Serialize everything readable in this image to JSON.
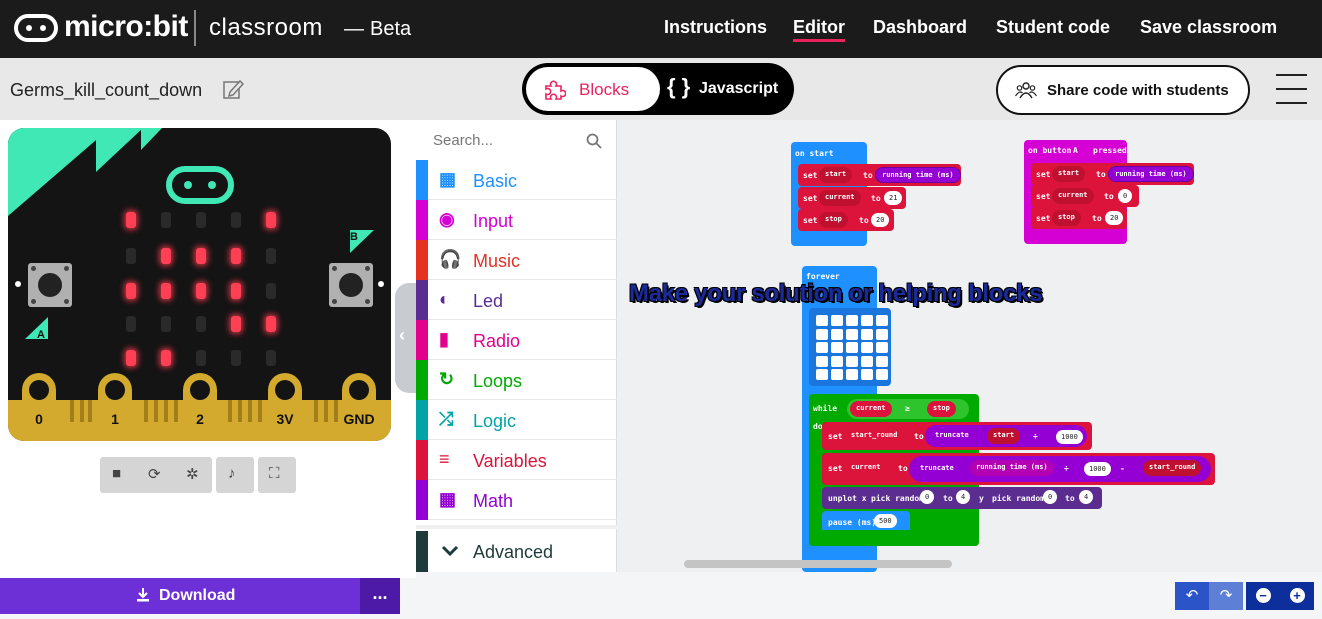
{
  "header": {
    "brand": "micro:bit",
    "product": "classroom",
    "dash": "—",
    "beta": "Beta",
    "nav": [
      "Instructions",
      "Editor",
      "Dashboard",
      "Student code",
      "Save classroom"
    ],
    "active_nav": "Editor"
  },
  "project": {
    "name": "Germs_kill_count_down"
  },
  "editor_toggle": {
    "blocks": "Blocks",
    "javascript": "Javascript",
    "selected": "Blocks"
  },
  "share": {
    "label": "Share code with students"
  },
  "simulator": {
    "leds_on": [
      [
        1,
        0,
        0,
        0,
        1
      ],
      [
        0,
        1,
        1,
        1,
        0
      ],
      [
        1,
        1,
        1,
        1,
        0
      ],
      [
        0,
        0,
        0,
        1,
        1
      ],
      [
        1,
        1,
        0,
        0,
        0
      ]
    ],
    "button_a": "A",
    "button_b": "B",
    "pins": [
      "0",
      "1",
      "2",
      "3V",
      "GND"
    ]
  },
  "toolbox": {
    "search_placeholder": "Search...",
    "categories": [
      {
        "label": "Basic",
        "color": "#1e90ff"
      },
      {
        "label": "Input",
        "color": "#d400d4"
      },
      {
        "label": "Music",
        "color": "#e63022"
      },
      {
        "label": "Led",
        "color": "#5c2d91"
      },
      {
        "label": "Radio",
        "color": "#e3008c"
      },
      {
        "label": "Loops",
        "color": "#00aa00"
      },
      {
        "label": "Logic",
        "color": "#00a4a6"
      },
      {
        "label": "Variables",
        "color": "#dc143c"
      },
      {
        "label": "Math",
        "color": "#9400d3"
      }
    ],
    "advanced": "Advanced"
  },
  "workspace": {
    "overlay_text": "Make your solution or helping blocks",
    "on_start": {
      "header": "on start",
      "rows": [
        {
          "set": "set",
          "var": "start",
          "to": "to",
          "value": "running time (ms)"
        },
        {
          "set": "set",
          "var": "current",
          "to": "to",
          "value": "21"
        },
        {
          "set": "set",
          "var": "stop",
          "to": "to",
          "value": "20"
        }
      ]
    },
    "on_button": {
      "header": "on button",
      "button": "A",
      "event": "pressed",
      "rows": [
        {
          "set": "set",
          "var": "start",
          "to": "to",
          "value": "running time (ms)"
        },
        {
          "set": "set",
          "var": "current",
          "to": "to",
          "value": "0"
        },
        {
          "set": "set",
          "var": "stop",
          "to": "to",
          "value": "20"
        }
      ]
    },
    "forever": {
      "header": "forever",
      "while": "while",
      "do": "do",
      "cond_left": "current",
      "cond_op": "≥",
      "cond_right": "stop",
      "set1": {
        "set": "set",
        "var": "start_round",
        "to": "to",
        "fn": "truncate",
        "a": "start",
        "op": "÷",
        "b": "1000"
      },
      "set2": {
        "set": "set",
        "var": "current",
        "to": "to",
        "fn": "truncate",
        "a": "running time (ms)",
        "op": "÷",
        "b": "1000",
        "op2": "-",
        "c": "start_round"
      },
      "unplot": {
        "label": "unplot x",
        "pick1": "pick random",
        "r1a": "0",
        "to1": "to",
        "r1b": "4",
        "y": "y",
        "pick2": "pick random",
        "r2a": "0",
        "to2": "to",
        "r2b": "4"
      },
      "pause": {
        "label": "pause (ms)",
        "value": "500"
      }
    }
  },
  "footer": {
    "download": "Download",
    "more": "..."
  },
  "colors": {
    "accent": "#e9235e",
    "download": "#6d2fd6",
    "topbar": "#1b1b1b"
  }
}
